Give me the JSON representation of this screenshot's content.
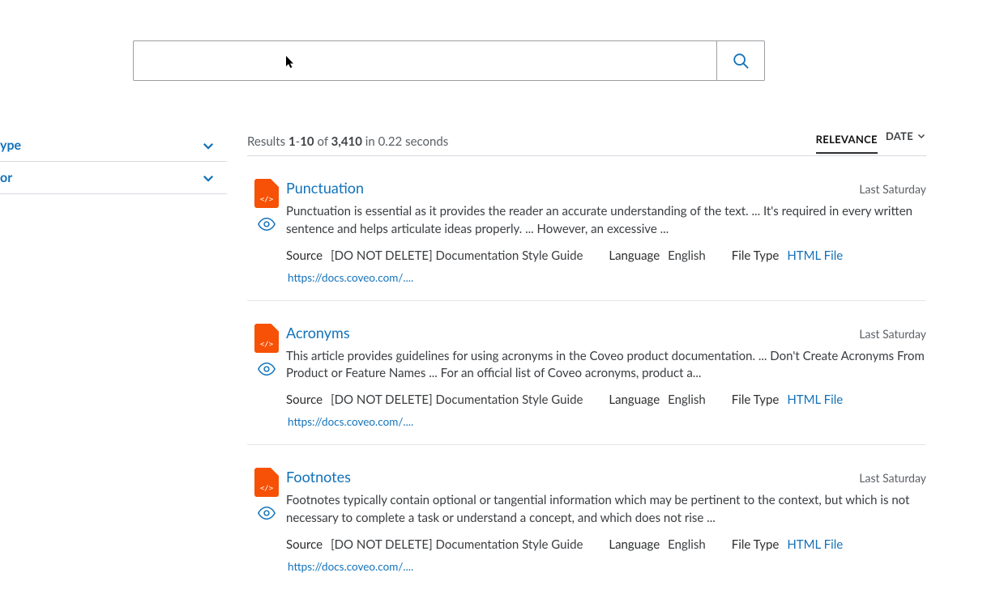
{
  "search": {
    "value": "",
    "placeholder": ""
  },
  "facets": [
    {
      "label": "ype"
    },
    {
      "label": "or"
    }
  ],
  "summary": {
    "prefix": "Results ",
    "from": "1",
    "dash": "-",
    "to": "10",
    "of_word": " of ",
    "total": "3,410",
    "time_prefix": " in ",
    "time": "0.22 seconds"
  },
  "sort": {
    "relevance": "RELEVANCE",
    "date": "DATE"
  },
  "meta_labels": {
    "source": "Source",
    "language": "Language",
    "filetype": "File Type"
  },
  "file_icon_code": "</>",
  "results": [
    {
      "title": "Punctuation",
      "date": "Last Saturday",
      "excerpt": "Punctuation is essential as it provides the reader an accurate understanding of the text. ... It's required in every written sentence and helps articulate ideas properly. ... However, an excessive ...",
      "source": "[DO NOT DELETE] Documentation Style Guide",
      "language": "English",
      "filetype": "HTML File",
      "url": "https://docs.coveo.com/...."
    },
    {
      "title": "Acronyms",
      "date": "Last Saturday",
      "excerpt": "This article provides guidelines for using acronyms in the Coveo product documentation. ... Don't Create Acronyms From Product or Feature Names ... For an official list of Coveo acronyms, product a...",
      "source": "[DO NOT DELETE] Documentation Style Guide",
      "language": "English",
      "filetype": "HTML File",
      "url": "https://docs.coveo.com/...."
    },
    {
      "title": "Footnotes",
      "date": "Last Saturday",
      "excerpt": "Footnotes typically contain optional or tangential information which may be pertinent to the context, but which is not necessary to complete a task or understand a concept, and which does not rise ...",
      "source": "[DO NOT DELETE] Documentation Style Guide",
      "language": "English",
      "filetype": "HTML File",
      "url": "https://docs.coveo.com/...."
    }
  ]
}
